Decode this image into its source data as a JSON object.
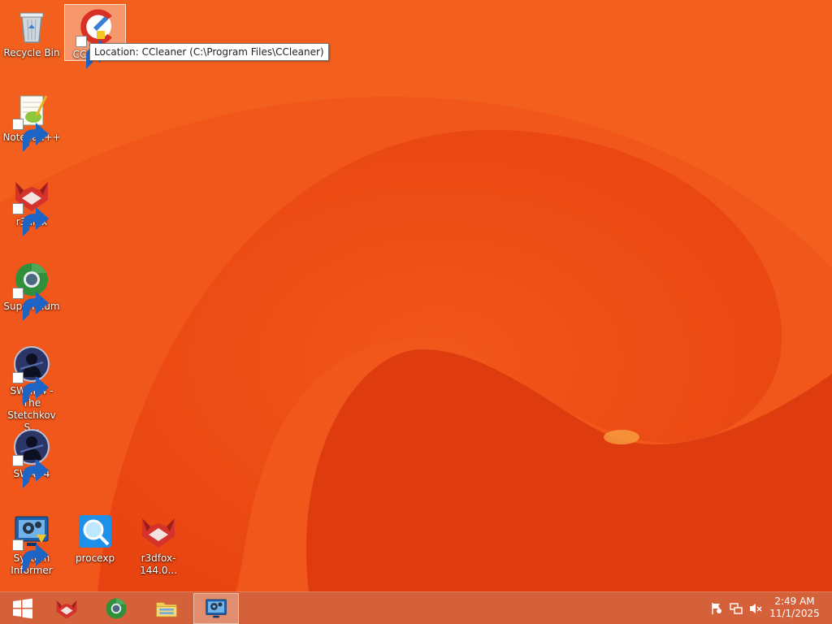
{
  "desktop": {
    "icons": [
      {
        "label": "Recycle Bin"
      },
      {
        "label": "CCleaner"
      },
      {
        "label": "Notepad++"
      },
      {
        "label": "r3dfox"
      },
      {
        "label": "Supermium"
      },
      {
        "label": "SWAT 4 - The Stetchkov S..."
      },
      {
        "label": "SWAT 4"
      },
      {
        "label": "System Informer"
      },
      {
        "label": "procexp"
      },
      {
        "label": "r3dfox-144.0..."
      }
    ],
    "tooltip": "Location: CCleaner (C:\\Program Files\\CCleaner)"
  },
  "taskbar": {
    "pinned": [
      {
        "icon": "windows-logo-icon"
      },
      {
        "icon": "r3dfox-icon"
      },
      {
        "icon": "supermium-icon"
      },
      {
        "icon": "file-explorer-icon"
      },
      {
        "icon": "system-informer-icon"
      }
    ],
    "tray": {
      "icons": [
        "action-center-flag-icon",
        "network-icon",
        "speaker-muted-icon"
      ],
      "time": "2:49 AM",
      "date": "11/1/2025"
    }
  },
  "colors": {
    "wallpaper": "#ef4d12",
    "taskbar": "#d5613a",
    "selection": "#ffffff"
  }
}
